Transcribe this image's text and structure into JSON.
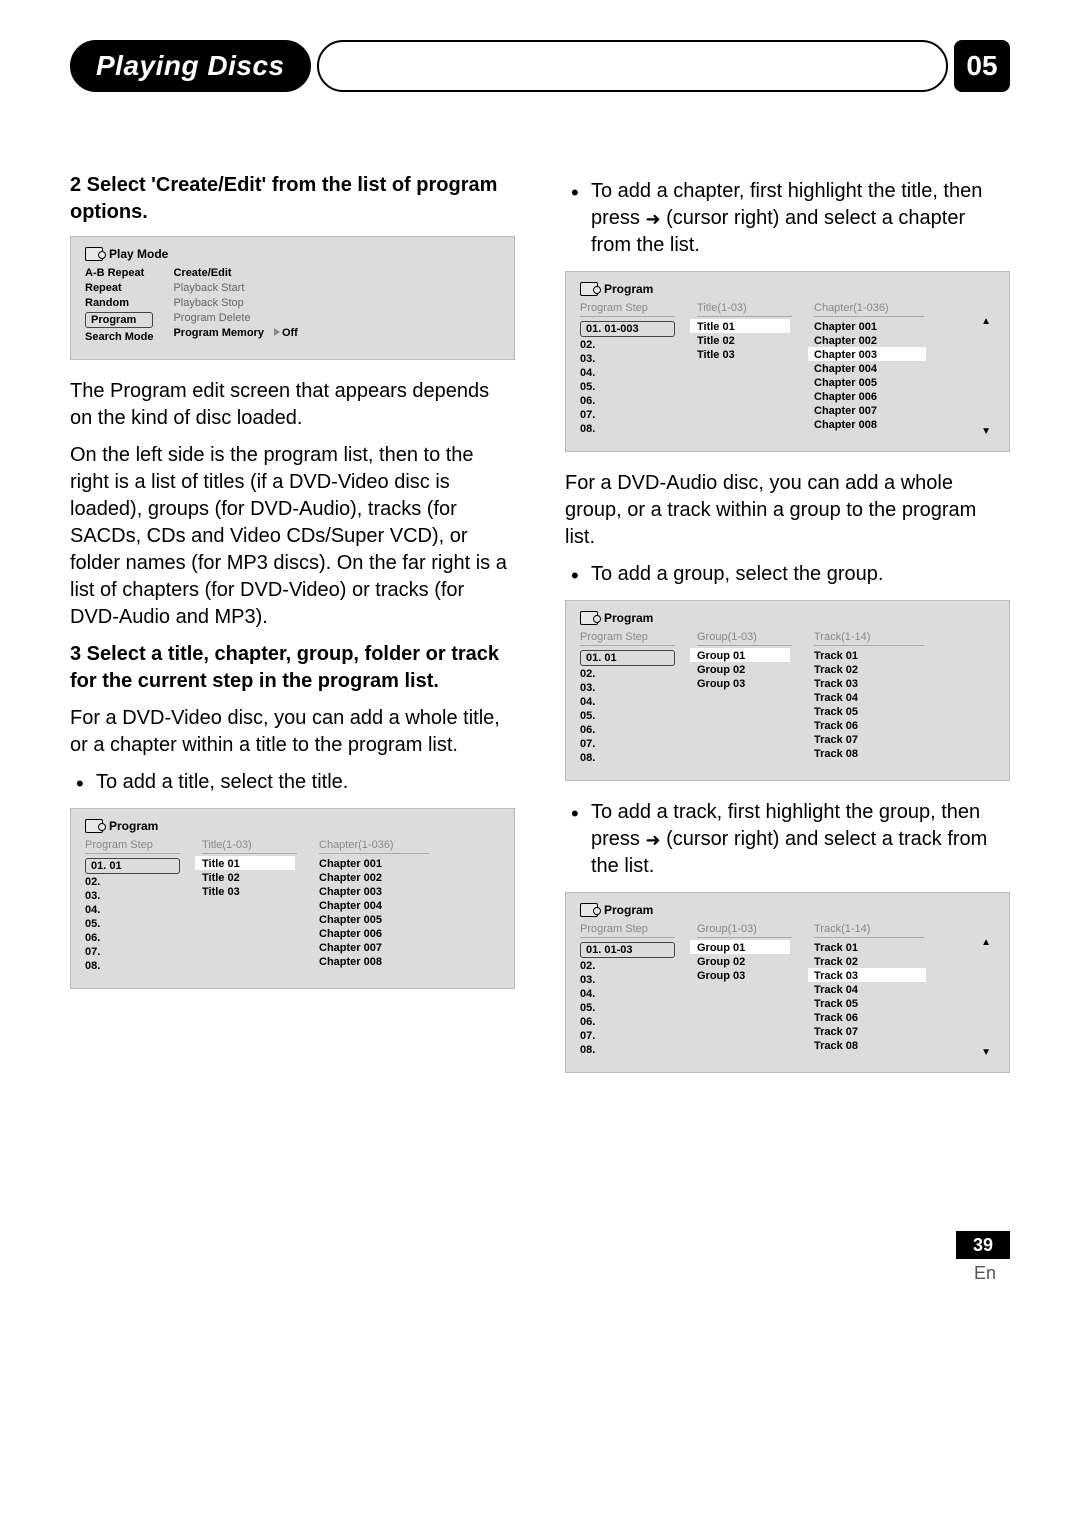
{
  "header": {
    "section_title": "Playing Discs",
    "chapter_number": "05"
  },
  "left": {
    "step2_head": "2    Select 'Create/Edit' from the list of program options.",
    "osd_play_mode": {
      "title": "Play Mode",
      "left_items": [
        "A-B Repeat",
        "Repeat",
        "Random",
        "Program",
        "Search Mode"
      ],
      "right_items": [
        "Create/Edit",
        "Playback Start",
        "Playback Stop",
        "Program Delete",
        "Program Memory"
      ],
      "mem_value": "Off"
    },
    "para1": "The Program edit screen that appears depends on the kind of disc loaded.",
    "para2": "On the left side is the program list, then to the right is a list of titles (if a DVD-Video disc is loaded), groups (for DVD-Audio), tracks (for SACDs, CDs and Video CDs/Super VCD), or folder names (for MP3 discs). On the far right is a list of chapters (for DVD-Video) or tracks (for DVD-Audio and MP3).",
    "step3_head": "3    Select a title, chapter, group, folder or track for the current step in the program list.",
    "para3": "For a DVD-Video disc, you can add a whole title, or a chapter within a title to the program list.",
    "bullet1": "To add a title, select the title.",
    "osd_prog1": {
      "title": "Program",
      "col1_head": "Program Step",
      "col2_head": "Title(1-03)",
      "col3_head": "Chapter(1-036)",
      "step_sel": "01. 01",
      "steps": [
        "02.",
        "03.",
        "04.",
        "05.",
        "06.",
        "07.",
        "08."
      ],
      "titles": [
        "Title 01",
        "Title 02",
        "Title 03"
      ],
      "chapters": [
        "Chapter 001",
        "Chapter 002",
        "Chapter 003",
        "Chapter 004",
        "Chapter 005",
        "Chapter 006",
        "Chapter 007",
        "Chapter 008"
      ]
    }
  },
  "right": {
    "bullet1a": "To add a chapter, first highlight the title, then press ",
    "bullet1b": " (cursor right) and select a chapter from the list.",
    "osd_prog2": {
      "title": "Program",
      "col1_head": "Program Step",
      "col2_head": "Title(1-03)",
      "col3_head": "Chapter(1-036)",
      "step_sel": "01. 01-003",
      "steps": [
        "02.",
        "03.",
        "04.",
        "05.",
        "06.",
        "07.",
        "08."
      ],
      "titles": [
        "Title 01",
        "Title 02",
        "Title 03"
      ],
      "chapters": [
        "Chapter 001",
        "Chapter 002",
        "Chapter 003",
        "Chapter 004",
        "Chapter 005",
        "Chapter 006",
        "Chapter 007",
        "Chapter 008"
      ]
    },
    "para4": "For a DVD-Audio disc, you can add a whole group, or a track within a group to the program list.",
    "bullet2": "To add a group, select the group.",
    "osd_prog3": {
      "title": "Program",
      "col1_head": "Program Step",
      "col2_head": "Group(1-03)",
      "col3_head": "Track(1-14)",
      "step_sel": "01. 01",
      "steps": [
        "02.",
        "03.",
        "04.",
        "05.",
        "06.",
        "07.",
        "08."
      ],
      "groups": [
        "Group 01",
        "Group 02",
        "Group 03"
      ],
      "tracks": [
        "Track 01",
        "Track 02",
        "Track 03",
        "Track 04",
        "Track 05",
        "Track 06",
        "Track 07",
        "Track 08"
      ]
    },
    "bullet3a": "To add a track, first highlight the group, then press ",
    "bullet3b": " (cursor right) and select a track from the list.",
    "osd_prog4": {
      "title": "Program",
      "col1_head": "Program Step",
      "col2_head": "Group(1-03)",
      "col3_head": "Track(1-14)",
      "step_sel": "01. 01-03",
      "steps": [
        "02.",
        "03.",
        "04.",
        "05.",
        "06.",
        "07.",
        "08."
      ],
      "groups": [
        "Group 01",
        "Group 02",
        "Group 03"
      ],
      "tracks": [
        "Track 01",
        "Track 02",
        "Track 03",
        "Track 04",
        "Track 05",
        "Track 06",
        "Track 07",
        "Track 08"
      ]
    }
  },
  "footer": {
    "page": "39",
    "lang": "En"
  }
}
